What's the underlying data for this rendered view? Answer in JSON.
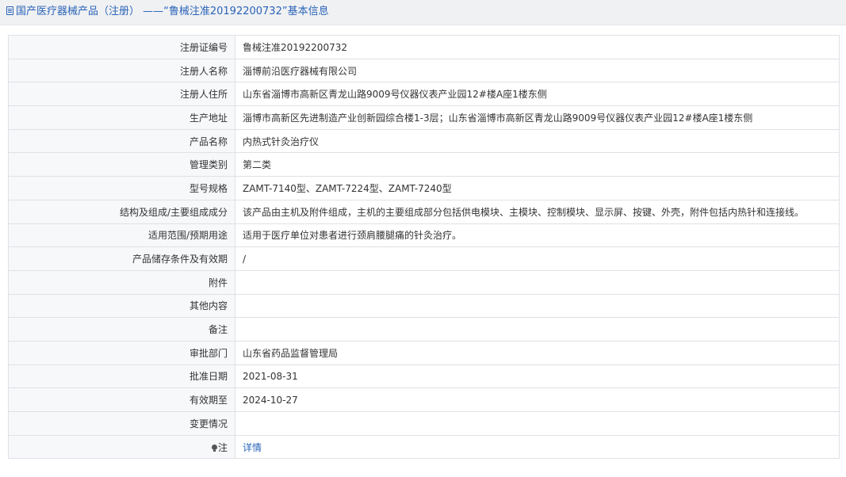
{
  "header": {
    "icon": "document-icon",
    "title": "国产医疗器械产品（注册） ——“鲁械注准20192200732”基本信息"
  },
  "rows": [
    {
      "label": "注册证编号",
      "value": "鲁械注准20192200732"
    },
    {
      "label": "注册人名称",
      "value": "淄博前沿医疗器械有限公司"
    },
    {
      "label": "注册人住所",
      "value": "山东省淄博市高新区青龙山路9009号仪器仪表产业园12#楼A座1楼东侧"
    },
    {
      "label": "生产地址",
      "value": "淄博市高新区先进制造产业创新园综合楼1-3层；山东省淄博市高新区青龙山路9009号仪器仪表产业园12#楼A座1楼东侧"
    },
    {
      "label": "产品名称",
      "value": "内热式针灸治疗仪"
    },
    {
      "label": "管理类别",
      "value": "第二类"
    },
    {
      "label": "型号规格",
      "value": "ZAMT-7140型、ZAMT-7224型、ZAMT-7240型"
    },
    {
      "label": "结构及组成/主要组成成分",
      "value": "该产品由主机及附件组成，主机的主要组成部分包括供电模块、主模块、控制模块、显示屏、按键、外壳，附件包括内热针和连接线。"
    },
    {
      "label": "适用范围/预期用途",
      "value": "适用于医疗单位对患者进行颈肩腰腿痛的针灸治疗。"
    },
    {
      "label": "产品储存条件及有效期",
      "value": "/"
    },
    {
      "label": "附件",
      "value": ""
    },
    {
      "label": "其他内容",
      "value": ""
    },
    {
      "label": "备注",
      "value": ""
    },
    {
      "label": "审批部门",
      "value": "山东省药品监督管理局"
    },
    {
      "label": "批准日期",
      "value": "2021-08-31"
    },
    {
      "label": "有效期至",
      "value": "2024-10-27"
    },
    {
      "label": "变更情况",
      "value": ""
    }
  ],
  "note": {
    "icon": "lightbulb-icon",
    "label": "注",
    "link": "详情"
  }
}
